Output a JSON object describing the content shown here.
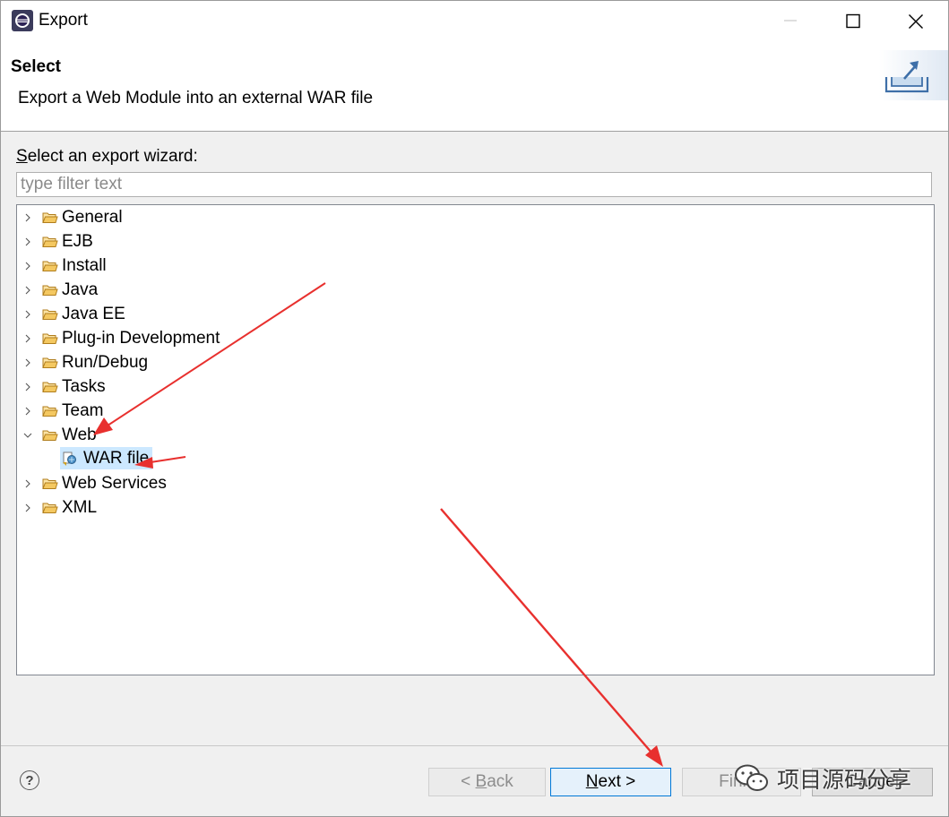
{
  "window": {
    "title": "Export",
    "app_icon": "eclipse-icon",
    "controls": [
      "minimize-icon",
      "maximize-icon",
      "close-icon"
    ]
  },
  "header": {
    "title": "Select",
    "description": "Export a Web Module into an external WAR file",
    "banner_icon": "export-tray-icon"
  },
  "wizard": {
    "filter_label_mnemonic": "S",
    "filter_label_rest": "elect an export wizard:",
    "filter_placeholder": "type filter text",
    "filter_value": ""
  },
  "tree": {
    "items": [
      {
        "label": "General",
        "expanded": false
      },
      {
        "label": "EJB",
        "expanded": false
      },
      {
        "label": "Install",
        "expanded": false
      },
      {
        "label": "Java",
        "expanded": false
      },
      {
        "label": "Java EE",
        "expanded": false
      },
      {
        "label": "Plug-in Development",
        "expanded": false
      },
      {
        "label": "Run/Debug",
        "expanded": false
      },
      {
        "label": "Tasks",
        "expanded": false
      },
      {
        "label": "Team",
        "expanded": false
      },
      {
        "label": "Web",
        "expanded": true,
        "children": [
          {
            "label": "WAR file",
            "selected": true
          }
        ]
      },
      {
        "label": "Web Services",
        "expanded": false
      },
      {
        "label": "XML",
        "expanded": false
      }
    ]
  },
  "buttons": {
    "help": "?",
    "back_prefix": "< ",
    "back_mnemonic": "B",
    "back_rest": "ack",
    "next_mnemonic": "N",
    "next_rest": "ext >",
    "finish": "Finish",
    "cancel": "Cancel"
  },
  "watermark": {
    "text": "项目源码分享",
    "icon": "wechat-icon"
  },
  "colors": {
    "selection": "#cce8ff",
    "default_button_border": "#0078d7",
    "annotation_arrow": "#e8302e",
    "folder": "#e8b64a"
  }
}
